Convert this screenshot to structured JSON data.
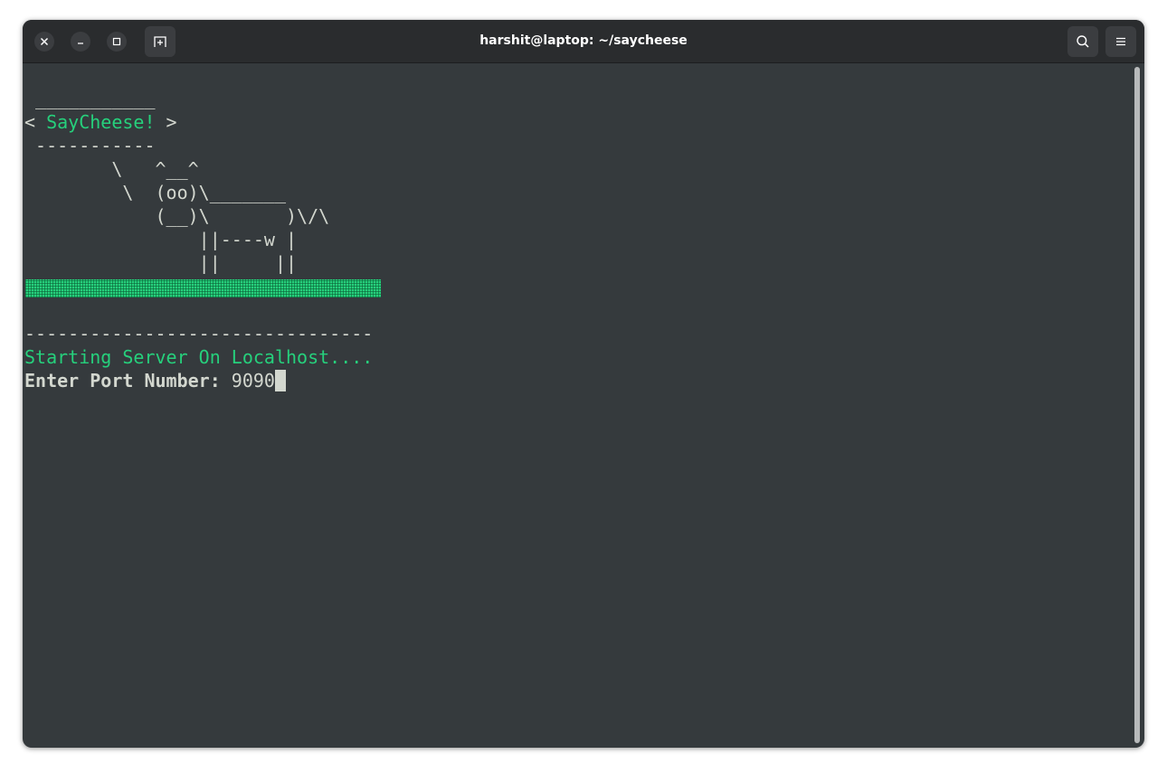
{
  "window": {
    "title": "harshit@laptop: ~/saycheese"
  },
  "icons": {
    "close": "close-icon",
    "minimize": "minimize-icon",
    "maximize": "maximize-icon",
    "new_tab": "new-tab-icon",
    "search": "search-icon",
    "menu": "hamburger-menu-icon"
  },
  "terminal": {
    "banner_top": " ___________",
    "banner_left": "< ",
    "banner_text": "SayCheese!",
    "banner_right": " >",
    "banner_bottom": " -----------",
    "cow_1": "        \\   ^__^",
    "cow_2": "         \\  (oo)\\_______",
    "cow_3": "            (__)\\       )\\/\\",
    "cow_4": "                ||----w |",
    "cow_5": "                ||     ||",
    "separator": "--------------------------------",
    "status": "Starting Server On Localhost....",
    "prompt_label": "Enter Port Number: ",
    "prompt_value": "9090"
  },
  "colors": {
    "accent_green": "#26d07c",
    "terminal_bg": "#353a3d",
    "text": "#d3d7cf"
  }
}
